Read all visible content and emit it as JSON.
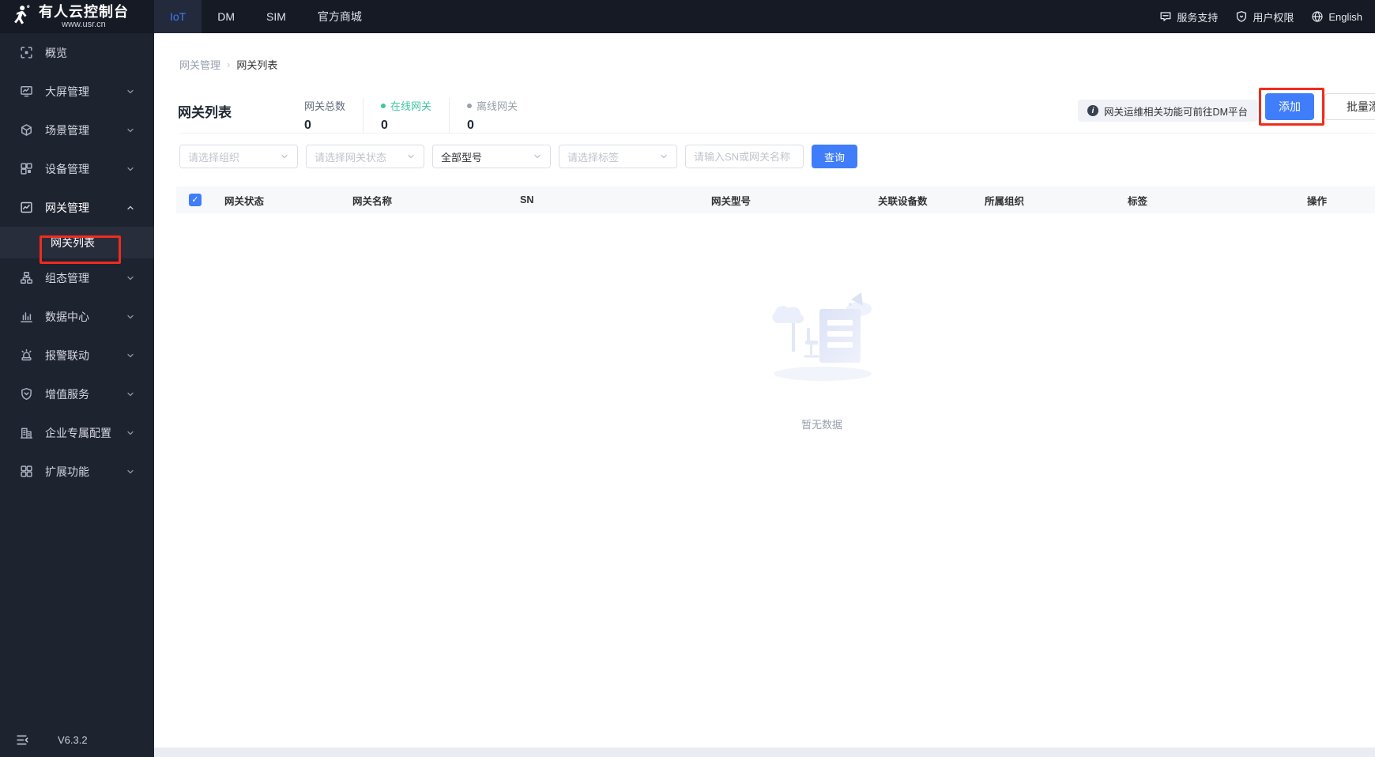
{
  "topbar": {
    "logo": {
      "title": "有人云控制台",
      "subtitle": "www.usr.cn"
    },
    "tabs": [
      {
        "label": "IoT",
        "active": true
      },
      {
        "label": "DM",
        "active": false
      },
      {
        "label": "SIM",
        "active": false
      },
      {
        "label": "官方商城",
        "active": false
      }
    ],
    "links": [
      {
        "label": "服务支持"
      },
      {
        "label": "用户权限"
      },
      {
        "label": "English"
      }
    ]
  },
  "sidebar": {
    "items": [
      {
        "label": "概览"
      },
      {
        "label": "大屏管理"
      },
      {
        "label": "场景管理"
      },
      {
        "label": "设备管理"
      },
      {
        "label": "网关管理",
        "expanded": true
      },
      {
        "label": "组态管理"
      },
      {
        "label": "数据中心"
      },
      {
        "label": "报警联动"
      },
      {
        "label": "增值服务"
      },
      {
        "label": "企业专属配置"
      },
      {
        "label": "扩展功能"
      }
    ],
    "sub_item": {
      "label": "网关列表",
      "selected": true
    },
    "version": "V6.3.2"
  },
  "breadcrumb": {
    "parent": "网关管理",
    "current": "网关列表"
  },
  "page": {
    "title": "网关列表",
    "stats": [
      {
        "label": "网关总数",
        "value": "0"
      },
      {
        "label": "在线网关",
        "value": "0"
      },
      {
        "label": "离线网关",
        "value": "0"
      }
    ],
    "notice": "网关运维相关功能可前往DM平台",
    "add_button": "添加",
    "batch_add_button": "批量添加"
  },
  "filters": {
    "org": "请选择组织",
    "status": "请选择网关状态",
    "model": "全部型号",
    "tag": "请选择标签",
    "sn": "请输入SN或网关名称",
    "search": "查询"
  },
  "table": {
    "columns": [
      "网关状态",
      "网关名称",
      "SN",
      "网关型号",
      "关联设备数",
      "所属组织",
      "标签",
      "操作"
    ],
    "empty_text": "暂无数据"
  },
  "icons": {
    "breadcrumb_separator": "›",
    "info": "i",
    "check": "✓"
  },
  "colors": {
    "accent": "#3f7dfa",
    "online_green": "#3dc79e",
    "annotation_red": "#f12b1e",
    "topbar_bg": "#161a24",
    "sidebar_bg": "#1e2330",
    "table_header_bg": "#f7f8fa"
  }
}
